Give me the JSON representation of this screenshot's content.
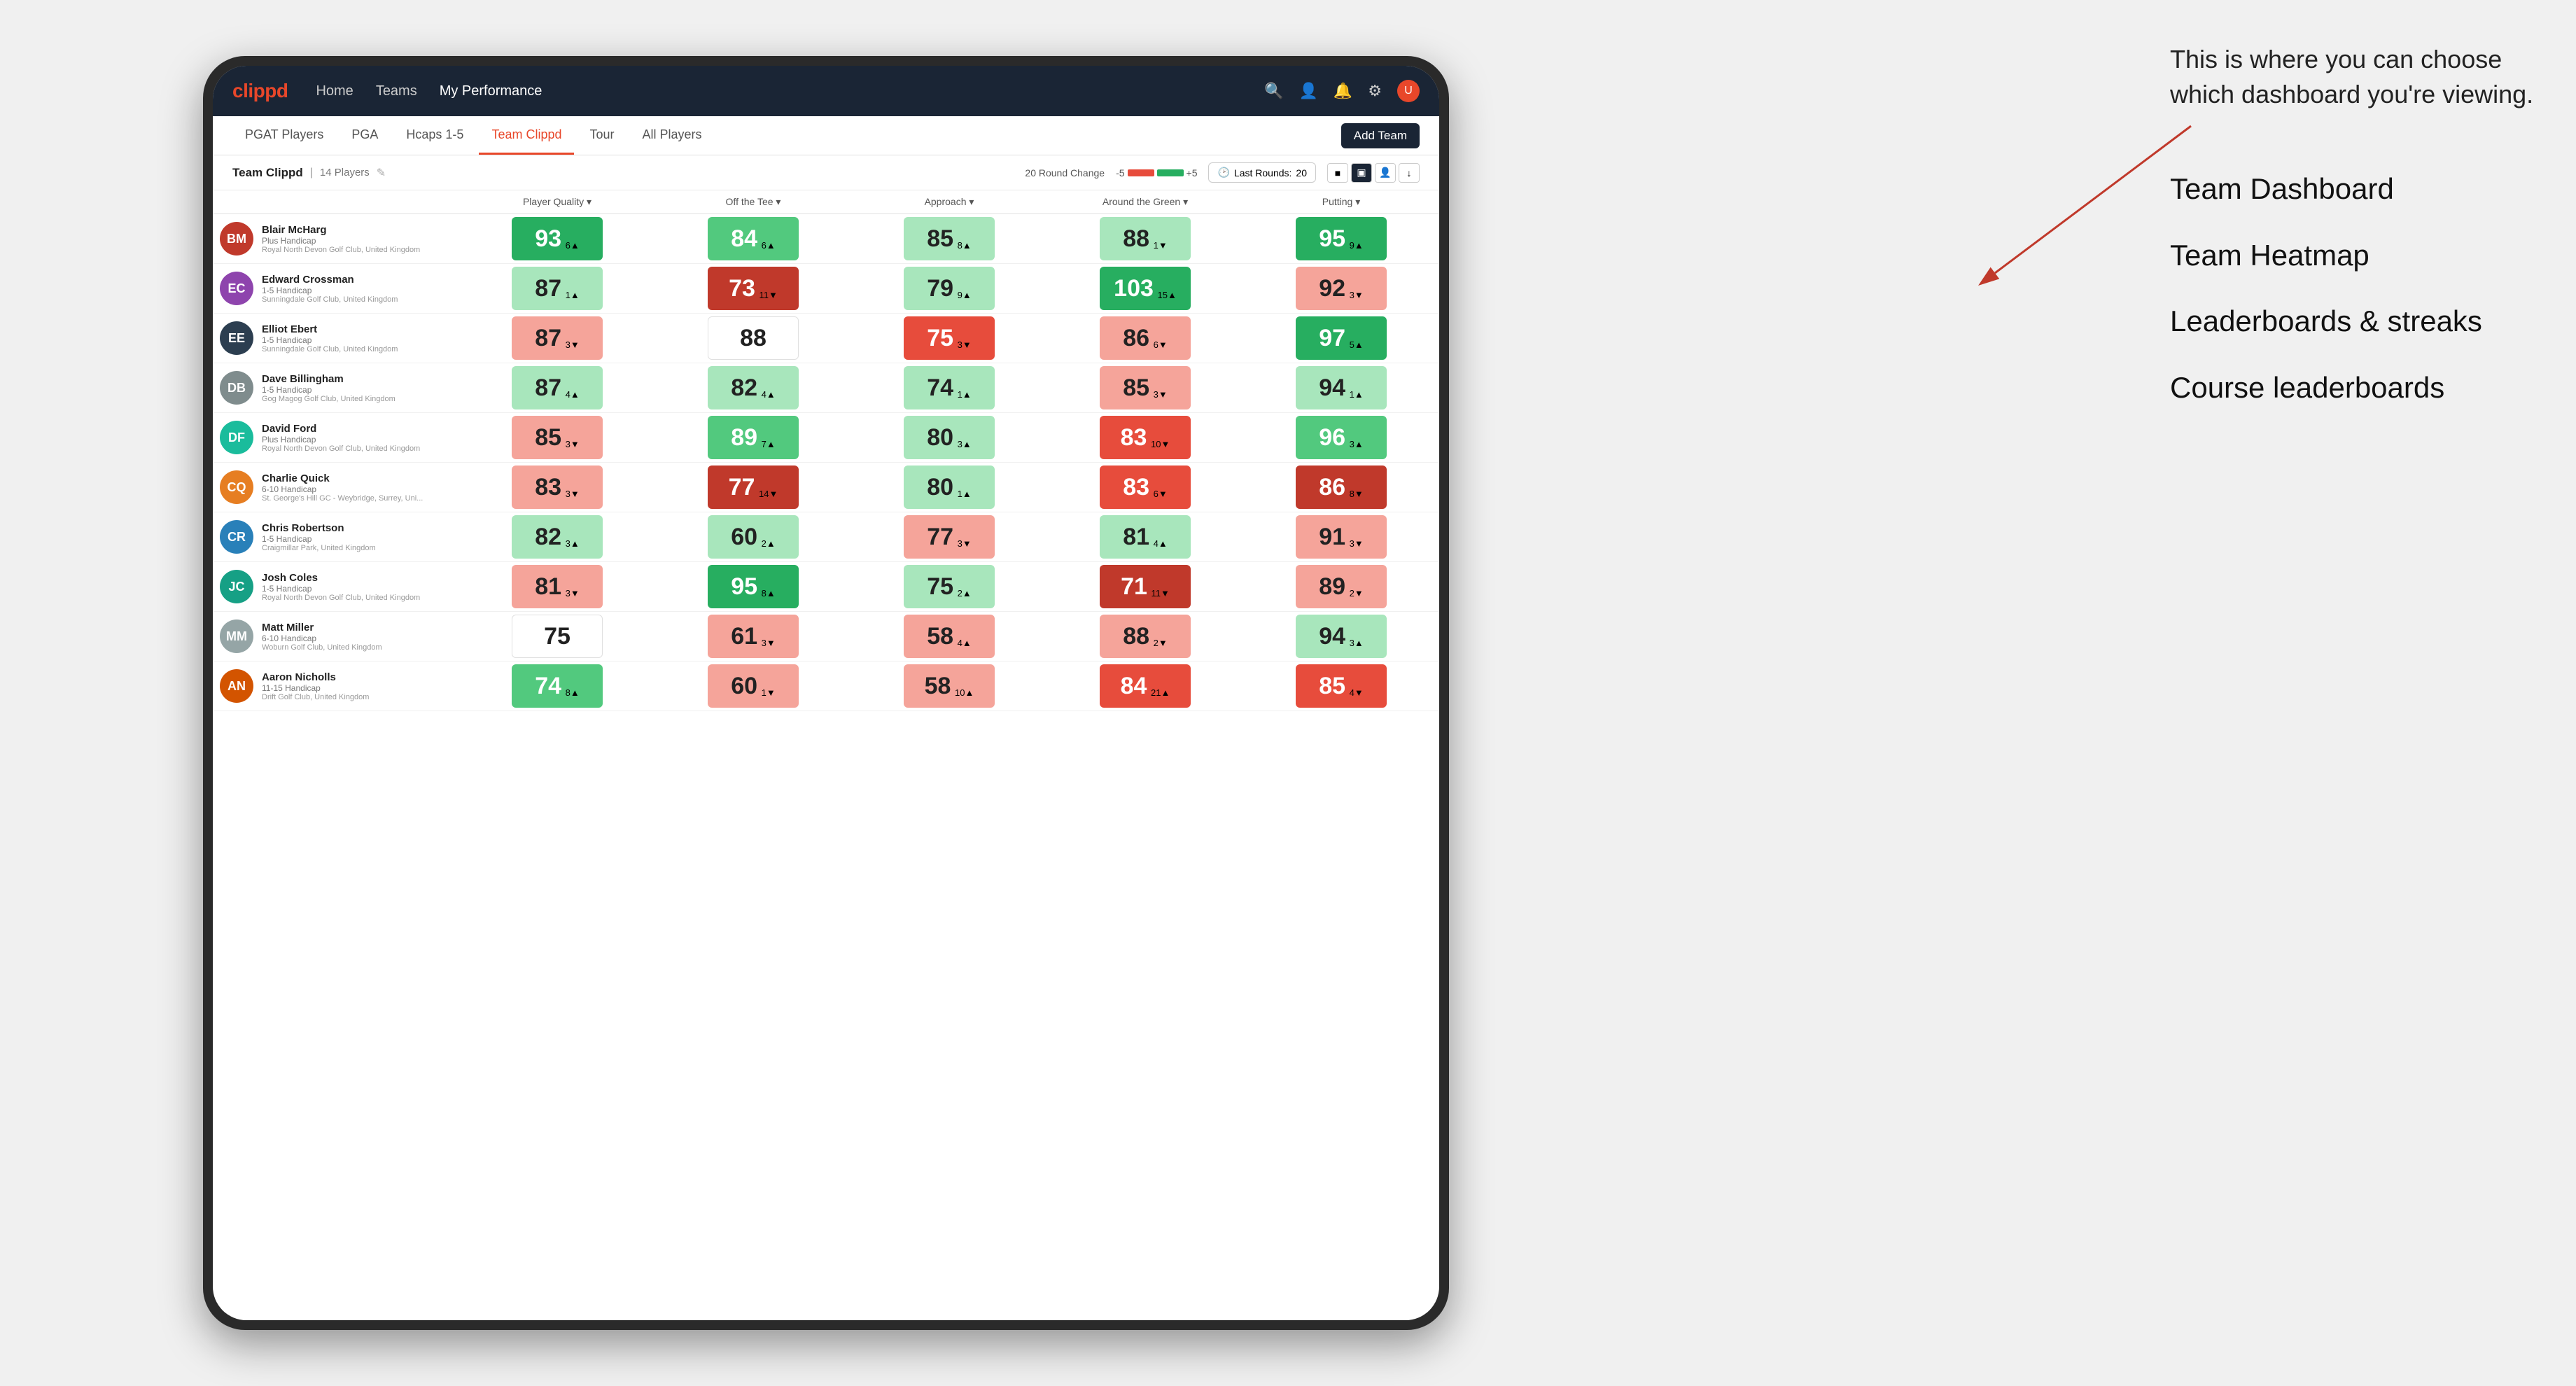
{
  "annotation": {
    "intro": "This is where you can choose which dashboard you're viewing.",
    "options": [
      "Team Dashboard",
      "Team Heatmap",
      "Leaderboards & streaks",
      "Course leaderboards"
    ]
  },
  "nav": {
    "logo": "clippd",
    "links": [
      "Home",
      "Teams",
      "My Performance"
    ],
    "active_link": "My Performance"
  },
  "sub_tabs": [
    "PGAT Players",
    "PGA",
    "Hcaps 1-5",
    "Team Clippd",
    "Tour",
    "All Players"
  ],
  "active_sub_tab": "Team Clippd",
  "add_team_label": "Add Team",
  "team": {
    "name": "Team Clippd",
    "count": "14 Players",
    "round_change_label": "20 Round Change",
    "round_change_neg": "-5",
    "round_change_pos": "+5",
    "last_rounds_label": "Last Rounds:",
    "last_rounds_value": "20"
  },
  "table": {
    "headers": [
      "Player Quality ▾",
      "Off the Tee ▾",
      "Approach ▾",
      "Around the Green ▾",
      "Putting ▾"
    ],
    "rows": [
      {
        "name": "Blair McHarg",
        "handicap": "Plus Handicap",
        "club": "Royal North Devon Golf Club, United Kingdom",
        "initials": "BM",
        "avatarColor": "#c0392b",
        "stats": [
          {
            "value": "93",
            "change": "6",
            "dir": "up",
            "bg": "bg-green-dark"
          },
          {
            "value": "84",
            "change": "6",
            "dir": "up",
            "bg": "bg-green-mid"
          },
          {
            "value": "85",
            "change": "8",
            "dir": "up",
            "bg": "bg-green-light"
          },
          {
            "value": "88",
            "change": "1",
            "dir": "down",
            "bg": "bg-green-light"
          },
          {
            "value": "95",
            "change": "9",
            "dir": "up",
            "bg": "bg-green-dark"
          }
        ]
      },
      {
        "name": "Edward Crossman",
        "handicap": "1-5 Handicap",
        "club": "Sunningdale Golf Club, United Kingdom",
        "initials": "EC",
        "avatarColor": "#8e44ad",
        "stats": [
          {
            "value": "87",
            "change": "1",
            "dir": "up",
            "bg": "bg-green-light"
          },
          {
            "value": "73",
            "change": "11",
            "dir": "down",
            "bg": "bg-red-dark"
          },
          {
            "value": "79",
            "change": "9",
            "dir": "up",
            "bg": "bg-green-light"
          },
          {
            "value": "103",
            "change": "15",
            "dir": "up",
            "bg": "bg-green-dark"
          },
          {
            "value": "92",
            "change": "3",
            "dir": "down",
            "bg": "bg-red-light"
          }
        ]
      },
      {
        "name": "Elliot Ebert",
        "handicap": "1-5 Handicap",
        "club": "Sunningdale Golf Club, United Kingdom",
        "initials": "EE",
        "avatarColor": "#2c3e50",
        "stats": [
          {
            "value": "87",
            "change": "3",
            "dir": "down",
            "bg": "bg-red-light"
          },
          {
            "value": "88",
            "change": "",
            "dir": "",
            "bg": "bg-white"
          },
          {
            "value": "75",
            "change": "3",
            "dir": "down",
            "bg": "bg-red-mid"
          },
          {
            "value": "86",
            "change": "6",
            "dir": "down",
            "bg": "bg-red-light"
          },
          {
            "value": "97",
            "change": "5",
            "dir": "up",
            "bg": "bg-green-dark"
          }
        ]
      },
      {
        "name": "Dave Billingham",
        "handicap": "1-5 Handicap",
        "club": "Gog Magog Golf Club, United Kingdom",
        "initials": "DB",
        "avatarColor": "#7f8c8d",
        "stats": [
          {
            "value": "87",
            "change": "4",
            "dir": "up",
            "bg": "bg-green-light"
          },
          {
            "value": "82",
            "change": "4",
            "dir": "up",
            "bg": "bg-green-light"
          },
          {
            "value": "74",
            "change": "1",
            "dir": "up",
            "bg": "bg-green-light"
          },
          {
            "value": "85",
            "change": "3",
            "dir": "down",
            "bg": "bg-red-light"
          },
          {
            "value": "94",
            "change": "1",
            "dir": "up",
            "bg": "bg-green-light"
          }
        ]
      },
      {
        "name": "David Ford",
        "handicap": "Plus Handicap",
        "club": "Royal North Devon Golf Club, United Kingdom",
        "initials": "DF",
        "avatarColor": "#1abc9c",
        "stats": [
          {
            "value": "85",
            "change": "3",
            "dir": "down",
            "bg": "bg-red-light"
          },
          {
            "value": "89",
            "change": "7",
            "dir": "up",
            "bg": "bg-green-mid"
          },
          {
            "value": "80",
            "change": "3",
            "dir": "up",
            "bg": "bg-green-light"
          },
          {
            "value": "83",
            "change": "10",
            "dir": "down",
            "bg": "bg-red-mid"
          },
          {
            "value": "96",
            "change": "3",
            "dir": "up",
            "bg": "bg-green-mid"
          }
        ]
      },
      {
        "name": "Charlie Quick",
        "handicap": "6-10 Handicap",
        "club": "St. George's Hill GC - Weybridge, Surrey, Uni...",
        "initials": "CQ",
        "avatarColor": "#e67e22",
        "stats": [
          {
            "value": "83",
            "change": "3",
            "dir": "down",
            "bg": "bg-red-light"
          },
          {
            "value": "77",
            "change": "14",
            "dir": "down",
            "bg": "bg-red-dark"
          },
          {
            "value": "80",
            "change": "1",
            "dir": "up",
            "bg": "bg-green-light"
          },
          {
            "value": "83",
            "change": "6",
            "dir": "down",
            "bg": "bg-red-mid"
          },
          {
            "value": "86",
            "change": "8",
            "dir": "down",
            "bg": "bg-red-dark"
          }
        ]
      },
      {
        "name": "Chris Robertson",
        "handicap": "1-5 Handicap",
        "club": "Craigmillar Park, United Kingdom",
        "initials": "CR",
        "avatarColor": "#2980b9",
        "stats": [
          {
            "value": "82",
            "change": "3",
            "dir": "up",
            "bg": "bg-green-light"
          },
          {
            "value": "60",
            "change": "2",
            "dir": "up",
            "bg": "bg-green-light"
          },
          {
            "value": "77",
            "change": "3",
            "dir": "down",
            "bg": "bg-red-light"
          },
          {
            "value": "81",
            "change": "4",
            "dir": "up",
            "bg": "bg-green-light"
          },
          {
            "value": "91",
            "change": "3",
            "dir": "down",
            "bg": "bg-red-light"
          }
        ]
      },
      {
        "name": "Josh Coles",
        "handicap": "1-5 Handicap",
        "club": "Royal North Devon Golf Club, United Kingdom",
        "initials": "JC",
        "avatarColor": "#16a085",
        "stats": [
          {
            "value": "81",
            "change": "3",
            "dir": "down",
            "bg": "bg-red-light"
          },
          {
            "value": "95",
            "change": "8",
            "dir": "up",
            "bg": "bg-green-dark"
          },
          {
            "value": "75",
            "change": "2",
            "dir": "up",
            "bg": "bg-green-light"
          },
          {
            "value": "71",
            "change": "11",
            "dir": "down",
            "bg": "bg-red-dark"
          },
          {
            "value": "89",
            "change": "2",
            "dir": "down",
            "bg": "bg-red-light"
          }
        ]
      },
      {
        "name": "Matt Miller",
        "handicap": "6-10 Handicap",
        "club": "Woburn Golf Club, United Kingdom",
        "initials": "MM",
        "avatarColor": "#95a5a6",
        "stats": [
          {
            "value": "75",
            "change": "",
            "dir": "",
            "bg": "bg-white"
          },
          {
            "value": "61",
            "change": "3",
            "dir": "down",
            "bg": "bg-red-light"
          },
          {
            "value": "58",
            "change": "4",
            "dir": "up",
            "bg": "bg-red-light"
          },
          {
            "value": "88",
            "change": "2",
            "dir": "down",
            "bg": "bg-red-light"
          },
          {
            "value": "94",
            "change": "3",
            "dir": "up",
            "bg": "bg-green-light"
          }
        ]
      },
      {
        "name": "Aaron Nicholls",
        "handicap": "11-15 Handicap",
        "club": "Drift Golf Club, United Kingdom",
        "initials": "AN",
        "avatarColor": "#d35400",
        "stats": [
          {
            "value": "74",
            "change": "8",
            "dir": "up",
            "bg": "bg-green-mid"
          },
          {
            "value": "60",
            "change": "1",
            "dir": "down",
            "bg": "bg-red-light"
          },
          {
            "value": "58",
            "change": "10",
            "dir": "up",
            "bg": "bg-red-light"
          },
          {
            "value": "84",
            "change": "21",
            "dir": "up",
            "bg": "bg-red-mid"
          },
          {
            "value": "85",
            "change": "4",
            "dir": "down",
            "bg": "bg-red-mid"
          }
        ]
      }
    ]
  }
}
